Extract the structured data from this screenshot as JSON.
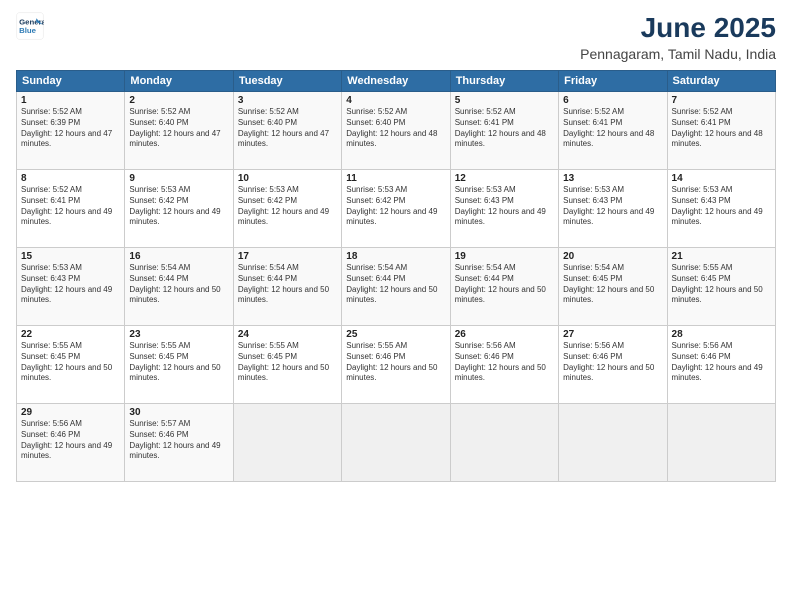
{
  "header": {
    "logo_line1": "General",
    "logo_line2": "Blue",
    "title": "June 2025",
    "subtitle": "Pennagaram, Tamil Nadu, India"
  },
  "days_of_week": [
    "Sunday",
    "Monday",
    "Tuesday",
    "Wednesday",
    "Thursday",
    "Friday",
    "Saturday"
  ],
  "weeks": [
    [
      {
        "day": "1",
        "sunrise": "5:52 AM",
        "sunset": "6:39 PM",
        "daylight": "12 hours and 47 minutes."
      },
      {
        "day": "2",
        "sunrise": "5:52 AM",
        "sunset": "6:40 PM",
        "daylight": "12 hours and 47 minutes."
      },
      {
        "day": "3",
        "sunrise": "5:52 AM",
        "sunset": "6:40 PM",
        "daylight": "12 hours and 47 minutes."
      },
      {
        "day": "4",
        "sunrise": "5:52 AM",
        "sunset": "6:40 PM",
        "daylight": "12 hours and 48 minutes."
      },
      {
        "day": "5",
        "sunrise": "5:52 AM",
        "sunset": "6:41 PM",
        "daylight": "12 hours and 48 minutes."
      },
      {
        "day": "6",
        "sunrise": "5:52 AM",
        "sunset": "6:41 PM",
        "daylight": "12 hours and 48 minutes."
      },
      {
        "day": "7",
        "sunrise": "5:52 AM",
        "sunset": "6:41 PM",
        "daylight": "12 hours and 48 minutes."
      }
    ],
    [
      {
        "day": "8",
        "sunrise": "5:52 AM",
        "sunset": "6:41 PM",
        "daylight": "12 hours and 49 minutes."
      },
      {
        "day": "9",
        "sunrise": "5:53 AM",
        "sunset": "6:42 PM",
        "daylight": "12 hours and 49 minutes."
      },
      {
        "day": "10",
        "sunrise": "5:53 AM",
        "sunset": "6:42 PM",
        "daylight": "12 hours and 49 minutes."
      },
      {
        "day": "11",
        "sunrise": "5:53 AM",
        "sunset": "6:42 PM",
        "daylight": "12 hours and 49 minutes."
      },
      {
        "day": "12",
        "sunrise": "5:53 AM",
        "sunset": "6:43 PM",
        "daylight": "12 hours and 49 minutes."
      },
      {
        "day": "13",
        "sunrise": "5:53 AM",
        "sunset": "6:43 PM",
        "daylight": "12 hours and 49 minutes."
      },
      {
        "day": "14",
        "sunrise": "5:53 AM",
        "sunset": "6:43 PM",
        "daylight": "12 hours and 49 minutes."
      }
    ],
    [
      {
        "day": "15",
        "sunrise": "5:53 AM",
        "sunset": "6:43 PM",
        "daylight": "12 hours and 49 minutes."
      },
      {
        "day": "16",
        "sunrise": "5:54 AM",
        "sunset": "6:44 PM",
        "daylight": "12 hours and 50 minutes."
      },
      {
        "day": "17",
        "sunrise": "5:54 AM",
        "sunset": "6:44 PM",
        "daylight": "12 hours and 50 minutes."
      },
      {
        "day": "18",
        "sunrise": "5:54 AM",
        "sunset": "6:44 PM",
        "daylight": "12 hours and 50 minutes."
      },
      {
        "day": "19",
        "sunrise": "5:54 AM",
        "sunset": "6:44 PM",
        "daylight": "12 hours and 50 minutes."
      },
      {
        "day": "20",
        "sunrise": "5:54 AM",
        "sunset": "6:45 PM",
        "daylight": "12 hours and 50 minutes."
      },
      {
        "day": "21",
        "sunrise": "5:55 AM",
        "sunset": "6:45 PM",
        "daylight": "12 hours and 50 minutes."
      }
    ],
    [
      {
        "day": "22",
        "sunrise": "5:55 AM",
        "sunset": "6:45 PM",
        "daylight": "12 hours and 50 minutes."
      },
      {
        "day": "23",
        "sunrise": "5:55 AM",
        "sunset": "6:45 PM",
        "daylight": "12 hours and 50 minutes."
      },
      {
        "day": "24",
        "sunrise": "5:55 AM",
        "sunset": "6:45 PM",
        "daylight": "12 hours and 50 minutes."
      },
      {
        "day": "25",
        "sunrise": "5:55 AM",
        "sunset": "6:46 PM",
        "daylight": "12 hours and 50 minutes."
      },
      {
        "day": "26",
        "sunrise": "5:56 AM",
        "sunset": "6:46 PM",
        "daylight": "12 hours and 50 minutes."
      },
      {
        "day": "27",
        "sunrise": "5:56 AM",
        "sunset": "6:46 PM",
        "daylight": "12 hours and 50 minutes."
      },
      {
        "day": "28",
        "sunrise": "5:56 AM",
        "sunset": "6:46 PM",
        "daylight": "12 hours and 49 minutes."
      }
    ],
    [
      {
        "day": "29",
        "sunrise": "5:56 AM",
        "sunset": "6:46 PM",
        "daylight": "12 hours and 49 minutes."
      },
      {
        "day": "30",
        "sunrise": "5:57 AM",
        "sunset": "6:46 PM",
        "daylight": "12 hours and 49 minutes."
      },
      null,
      null,
      null,
      null,
      null
    ]
  ],
  "labels": {
    "sunrise": "Sunrise:",
    "sunset": "Sunset:",
    "daylight": "Daylight:"
  }
}
